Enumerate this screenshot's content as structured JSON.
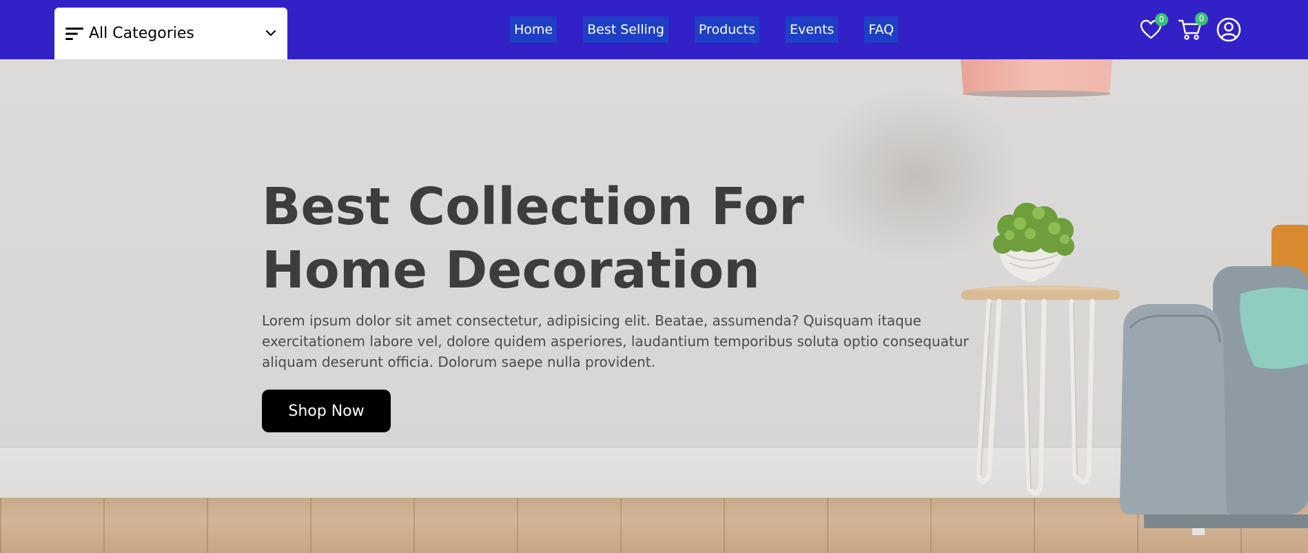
{
  "navbar": {
    "background": "#3321c8",
    "categories": {
      "label": "All Categories",
      "icon": "menu-icon",
      "chevron": "chevron-down-icon"
    },
    "links": [
      {
        "label": "Home"
      },
      {
        "label": "Best Selling"
      },
      {
        "label": "Products"
      },
      {
        "label": "Events"
      },
      {
        "label": "FAQ"
      }
    ],
    "wishlist": {
      "icon": "heart-icon",
      "count": "0"
    },
    "cart": {
      "icon": "cart-icon",
      "count": "0"
    },
    "profile": {
      "icon": "user-circle-icon"
    },
    "badge_color": "#3bc177"
  },
  "hero": {
    "title_line1": "Best Collection For",
    "title_line2": "Home Decoration",
    "description": "Lorem ipsum dolor sit amet consectetur, adipisicing elit. Beatae, assumenda? Quisquam itaque exercitationem labore vel, dolore quidem asperiores, laudantium temporibus soluta optio consequatur aliquam deserunt officia. Dolorum saepe nulla provident.",
    "cta_label": "Shop Now"
  }
}
